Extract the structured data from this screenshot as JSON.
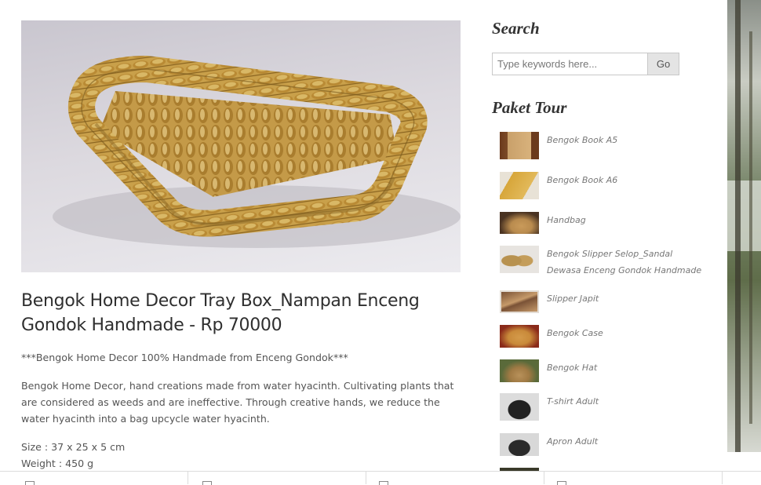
{
  "product": {
    "title": "Bengok Home Decor Tray Box_Nampan Enceng Gondok Handmade - Rp 70000",
    "tagline": "***Bengok Home Decor 100% Handmade from Enceng Gondok***",
    "description": "Bengok Home Decor, hand creations made from water hyacinth. Cultivating plants that are considered as weeds and are ineffective. Through creative hands, we reduce the water hyacinth into a bag upcycle water hyacinth.",
    "size": "Size : 37 x 25 x 5 cm",
    "weight": "Weight : 450 g"
  },
  "sidebar": {
    "search_heading": "Search",
    "search_placeholder": "Type keywords here...",
    "search_button": "Go",
    "paket_heading": "Paket Tour",
    "items": [
      {
        "label": "Bengok Book A5",
        "thumb_colors": [
          "#6b3a1c",
          "#c9a06a"
        ]
      },
      {
        "label": "Bengok Book A6",
        "thumb_colors": [
          "#e8e2d6",
          "#d7a63a"
        ]
      },
      {
        "label": "Handbag",
        "thumb_colors": [
          "#4a3322",
          "#b98b4e"
        ]
      },
      {
        "label": "Bengok Slipper Selop_Sandal Dewasa Enceng Gondok Handmade",
        "thumb_colors": [
          "#e7e4e0",
          "#b8924f"
        ]
      },
      {
        "label": "Slipper Japit",
        "thumb_colors": [
          "#7a5236",
          "#c69a6a"
        ]
      },
      {
        "label": "Bengok Case",
        "thumb_colors": [
          "#8a2a1a",
          "#d49a4a"
        ]
      },
      {
        "label": "Bengok Hat",
        "thumb_colors": [
          "#5a6a3a",
          "#b8915a"
        ]
      },
      {
        "label": "T-shirt Adult",
        "thumb_colors": [
          "#dcdcdc",
          "#222222"
        ]
      },
      {
        "label": "Apron Adult",
        "thumb_colors": [
          "#d8d8d8",
          "#2a2a2a"
        ]
      }
    ]
  }
}
